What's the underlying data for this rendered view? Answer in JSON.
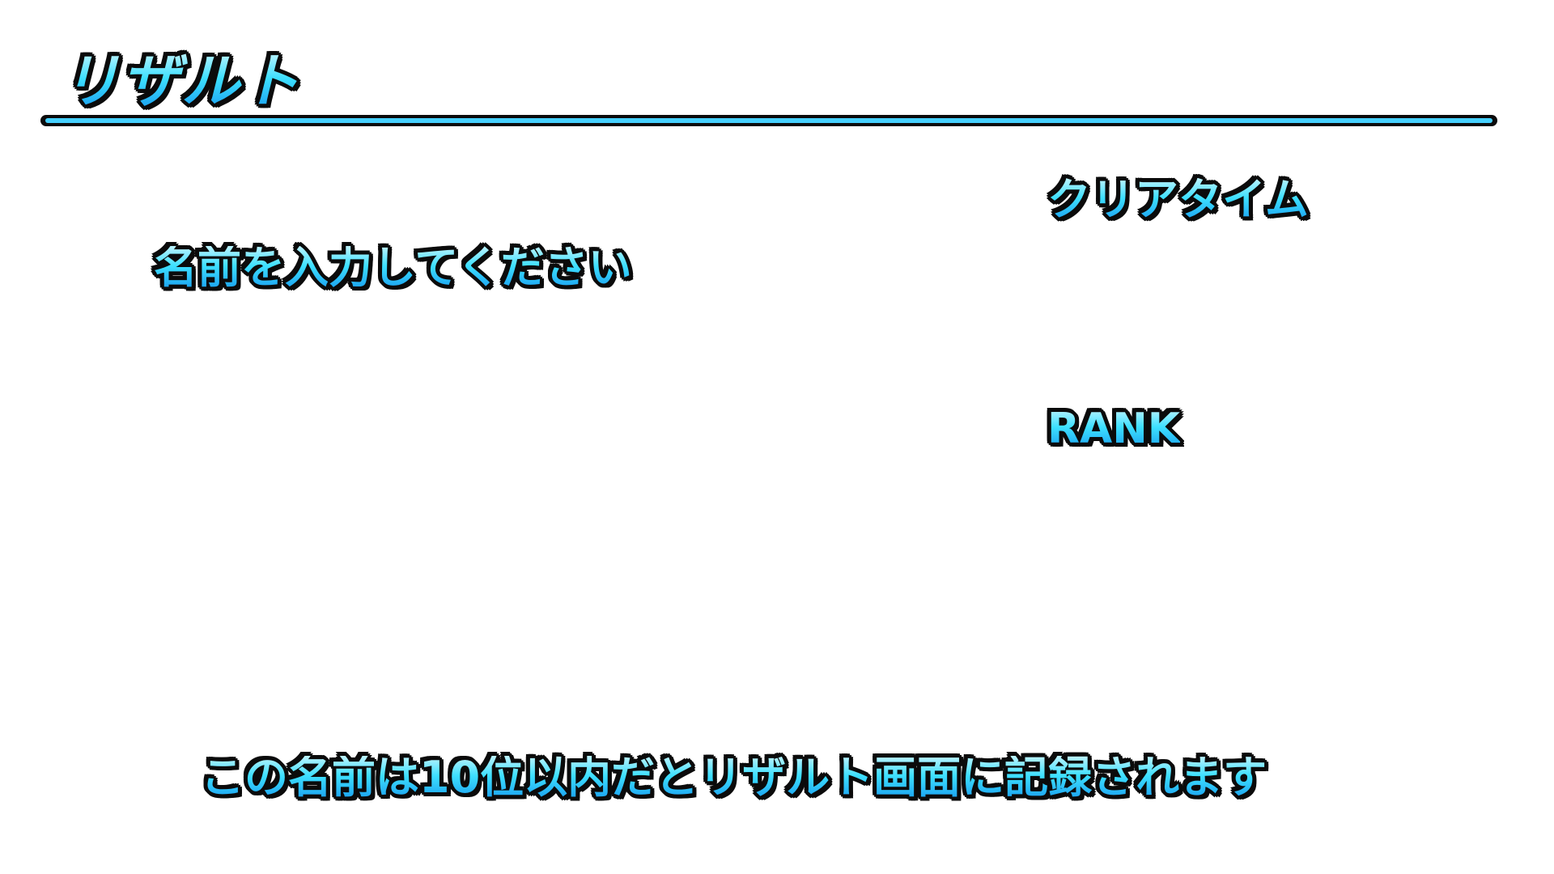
{
  "screen": {
    "title": "リザルト",
    "name_prompt": "名前を入力してください",
    "notice": "この名前は10位以内だとリザルト画面に記録されます"
  },
  "name_entry": {
    "value": "",
    "placeholder": ""
  },
  "results": {
    "clear_time_label": "クリアタイム",
    "clear_time_value": "",
    "rank_label": "RANK",
    "rank_value": ""
  },
  "colors": {
    "text_fill_top": "#bff4ff",
    "text_fill_mid": "#3ee0ff",
    "text_fill_bottom": "#1aa0f0",
    "text_outline": "#0b0b0b",
    "underline_accent": "#45d0ff",
    "background": "#ffffff"
  }
}
